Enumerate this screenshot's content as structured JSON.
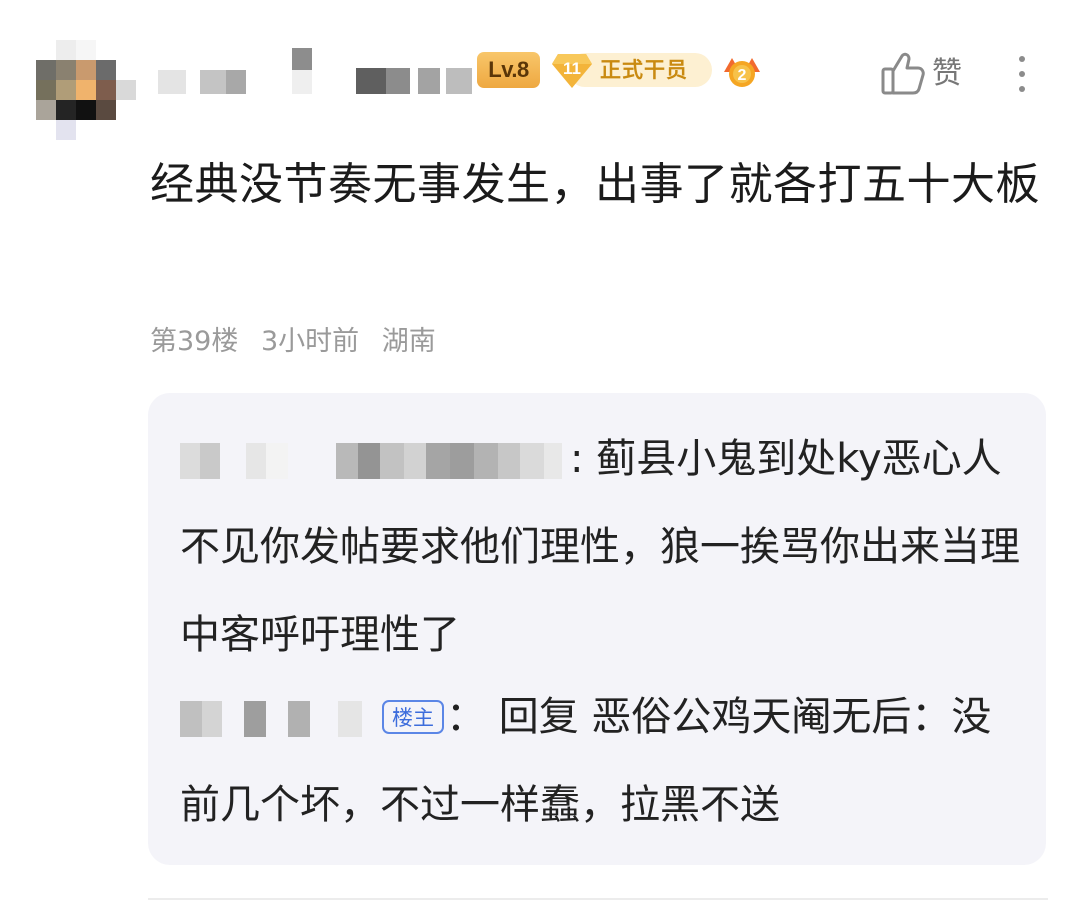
{
  "header": {
    "level_badge": "Lv.8",
    "title_badge_number": "11",
    "title_badge_label": "正式干员",
    "medal_number": "2",
    "like_label": "赞"
  },
  "comment": {
    "text": "经典没节奏无事发生，出事了就各打五十大板",
    "floor": "第39楼",
    "time": "3小时前",
    "location": "湖南"
  },
  "replies": [
    {
      "separator": ":",
      "text": "蓟县小鬼到处ky恶心人不见你发帖要求他们理性，狼一挨骂你出来当理中客呼吁理性了"
    },
    {
      "op_tag": "楼主",
      "separator": "：",
      "text": "回复 恶俗公鸡天阉无后：没前几个坏，不过一样蠢，拉黑不送"
    }
  ],
  "colors": {
    "reply_background": "#f4f4f9",
    "op_tag": "#3d6ddc",
    "badge_gold": "#eea841",
    "meta_text": "#9a9a9a"
  },
  "icons": {
    "like": "thumbs-up-icon",
    "more": "vertical-ellipsis-icon",
    "medal": "medal-icon"
  }
}
